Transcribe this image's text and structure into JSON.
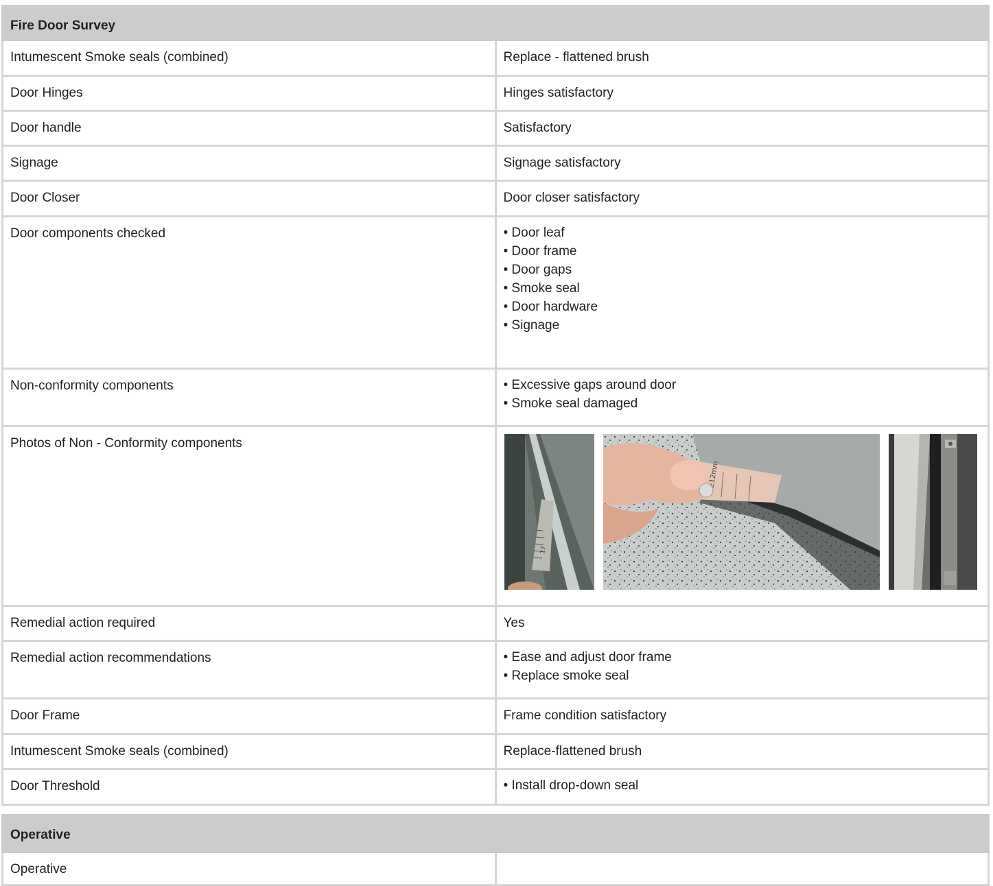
{
  "survey": {
    "title": "Fire Door Survey",
    "rows": [
      {
        "label": "Intumescent Smoke seals (combined)",
        "value": "Replace - flattened brush"
      },
      {
        "label": "Door Hinges",
        "value": "Hinges satisfactory"
      },
      {
        "label": "Door handle",
        "value": "Satisfactory"
      },
      {
        "label": "Signage",
        "value": "Signage satisfactory"
      },
      {
        "label": "Door Closer",
        "value": "Door closer satisfactory"
      },
      {
        "label": "Door components checked",
        "items": [
          "• Door leaf",
          "• Door frame",
          "• Door gaps",
          "• Smoke seal",
          "• Door hardware",
          "• Signage"
        ]
      },
      {
        "label": "Non-conformity components",
        "items": [
          "• Excessive gaps around door",
          "• Smoke seal damaged"
        ]
      },
      {
        "label": "Photos of Non - Conformity components"
      },
      {
        "label": "Remedial action required",
        "value": "Yes"
      },
      {
        "label": "Remedial action recommendations",
        "items": [
          "• Ease and adjust door frame",
          "• Replace smoke seal"
        ]
      },
      {
        "label": "Door Frame",
        "value": "Frame condition satisfactory"
      },
      {
        "label": "Intumescent Smoke seals (combined)",
        "value": "Replace-flattened brush"
      },
      {
        "label": "Door Threshold",
        "items": [
          "• Install drop-down seal"
        ]
      }
    ]
  },
  "operative": {
    "title": "Operative",
    "rows": [
      {
        "label": "Operative",
        "value": ""
      }
    ]
  },
  "photo_ruler_text": {
    "p1": "17",
    "p2": "±12mm"
  }
}
